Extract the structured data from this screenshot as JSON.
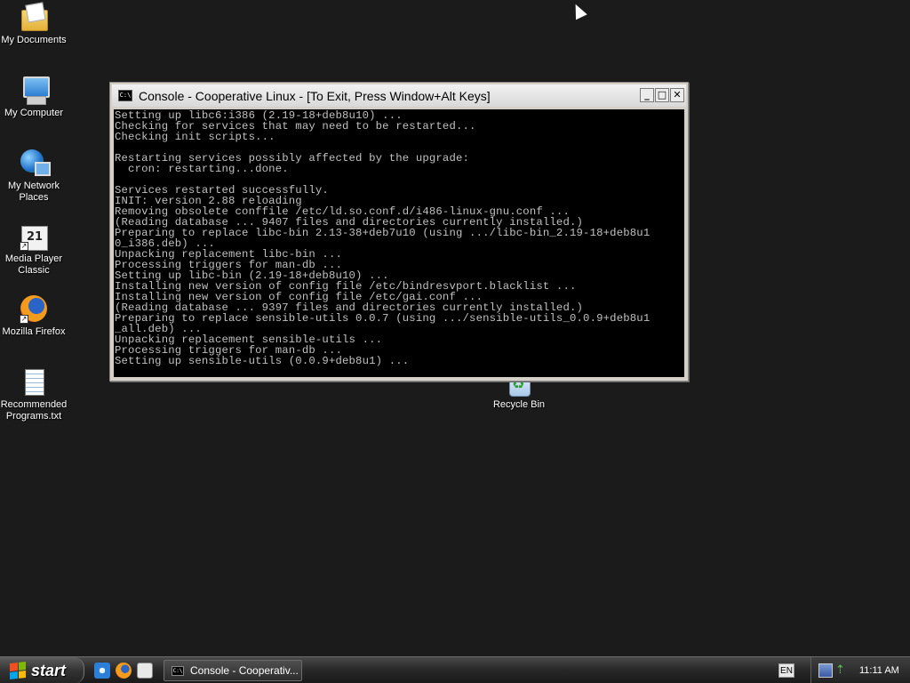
{
  "desktop": {
    "icons": [
      {
        "label": "My Documents",
        "icon": "my-documents-icon"
      },
      {
        "label": "My Computer",
        "icon": "my-computer-icon"
      },
      {
        "label": "My Network\nPlaces",
        "icon": "network-places-icon"
      },
      {
        "label": "Media Player\nClassic",
        "icon": "media-player-classic-icon"
      },
      {
        "label": "Mozilla Firefox",
        "icon": "firefox-icon"
      },
      {
        "label": "Recommended\nPrograms.txt",
        "icon": "text-file-icon"
      },
      {
        "label": "Recycle Bin",
        "icon": "recycle-bin-icon"
      }
    ]
  },
  "window": {
    "title": "Console - Cooperative Linux - [To Exit, Press Window+Alt Keys]",
    "icon": "console-icon",
    "icon_text": "C:\\",
    "buttons": {
      "minimize": "_",
      "maximize": "□",
      "close": "✕"
    },
    "console_lines": [
      "Setting up libc6:i386 (2.19-18+deb8u10) ...",
      "Checking for services that may need to be restarted...",
      "Checking init scripts...",
      "",
      "Restarting services possibly affected by the upgrade:",
      "  cron: restarting...done.",
      "",
      "Services restarted successfully.",
      "INIT: version 2.88 reloading",
      "Removing obsolete conffile /etc/ld.so.conf.d/i486-linux-gnu.conf ...",
      "(Reading database ... 9407 files and directories currently installed.)",
      "Preparing to replace libc-bin 2.13-38+deb7u10 (using .../libc-bin_2.19-18+deb8u1",
      "0_i386.deb) ...",
      "Unpacking replacement libc-bin ...",
      "Processing triggers for man-db ...",
      "Setting up libc-bin (2.19-18+deb8u10) ...",
      "Installing new version of config file /etc/bindresvport.blacklist ...",
      "Installing new version of config file /etc/gai.conf ...",
      "(Reading database ... 9397 files and directories currently installed.)",
      "Preparing to replace sensible-utils 0.0.7 (using .../sensible-utils_0.0.9+deb8u1",
      "_all.deb) ...",
      "Unpacking replacement sensible-utils ...",
      "Processing triggers for man-db ...",
      "Setting up sensible-utils (0.0.9+deb8u1) ..."
    ]
  },
  "taskbar": {
    "start_label": "start",
    "quick_launch": [
      "internet-explorer-icon",
      "firefox-icon",
      "media-player-classic-icon"
    ],
    "task_button_label": "Console - Cooperativ...",
    "language": "EN",
    "clock": "11:11 AM"
  },
  "colors": {
    "desktop_bg": "#1b1b1b",
    "console_bg": "#000000",
    "console_fg": "#c0c0c0"
  }
}
